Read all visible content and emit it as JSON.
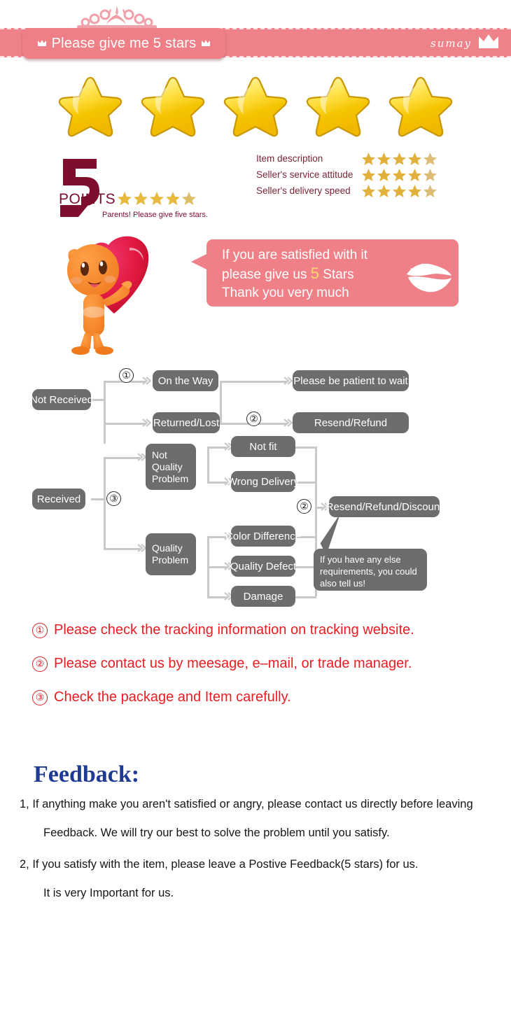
{
  "header": {
    "tab_label": "Please give me 5 stars",
    "brand_name": "sumay",
    "left_crown_icon": "crown-icon",
    "right_crown_icon": "crown-icon",
    "tiara_icon": "tiara-icon",
    "bar_color": "#ee8289",
    "tab_color": "#ef7f87",
    "dash_color": "#ffdfe2"
  },
  "big_stars": {
    "count": 5,
    "icon": "star-icon",
    "color": "#f5c518"
  },
  "points": {
    "number": "5",
    "word": "POINTS",
    "stars": 5,
    "subtitle": "Parents! Please give five stars.",
    "color": "#7d0e2e"
  },
  "ratings": {
    "rows": [
      {
        "label": "Item description",
        "stars": 5
      },
      {
        "label": "Seller's service attitude",
        "stars": 5
      },
      {
        "label": "Seller's delivery speed",
        "stars": 5
      }
    ],
    "label_color": "#7a2535",
    "star_color": "#e2b13c"
  },
  "promo": {
    "mascot_icon": "mascot-with-heart-icon",
    "lips_icon": "lips-kiss-icon",
    "bubble_color": "#ef8088",
    "highlight_color": "#fbd870",
    "line1": "If you are satisfied with it",
    "line2_pre": "please give us ",
    "line2_highlight": "5",
    "line2_post": " Stars",
    "line3": "Thank you very much"
  },
  "flow": {
    "box_color": "#6d6d6d",
    "line_color": "#c9c9c9",
    "boxes": {
      "not_received": "Not Received",
      "on_the_way": "On the Way",
      "returned_lost": "Returned/Lost",
      "be_patient": "Please be patient to wait",
      "resend_refund": "Resend/Refund",
      "received": "Received",
      "not_quality_problem": "Not\nQuality\nProblem",
      "quality_problem": "Quality\nProblem",
      "not_fit": "Not fit",
      "wrong_delivery": "Wrong Delivery",
      "color_difference": "Color Difference",
      "quality_defect": "Quality Defect",
      "damage": "Damage",
      "resend_refund_discount": "Resend/Refund/Discount"
    },
    "callout": "If you have any else requirements, you could also tell us!",
    "markers": {
      "m1": "①",
      "m2a": "②",
      "m2b": "②",
      "m3": "③"
    }
  },
  "notes": {
    "color": "#ee1b21",
    "items": [
      {
        "num": "①",
        "text": "Please check the tracking information on tracking website."
      },
      {
        "num": "②",
        "text": "Please contact us by meesage, e–mail, or trade manager."
      },
      {
        "num": "③",
        "text": "Check the package and Item carefully."
      }
    ]
  },
  "feedback": {
    "title": "Feedback:",
    "title_color": "#1f3a93",
    "lines": [
      "1, If anything make you aren't satisfied or angry, please contact us directly before leaving",
      "Feedback. We will try our best to solve the problem until you satisfy.",
      "2, If you satisfy with the item, please leave a Postive Feedback(5 stars) for us.",
      "It is very Important for us."
    ]
  }
}
